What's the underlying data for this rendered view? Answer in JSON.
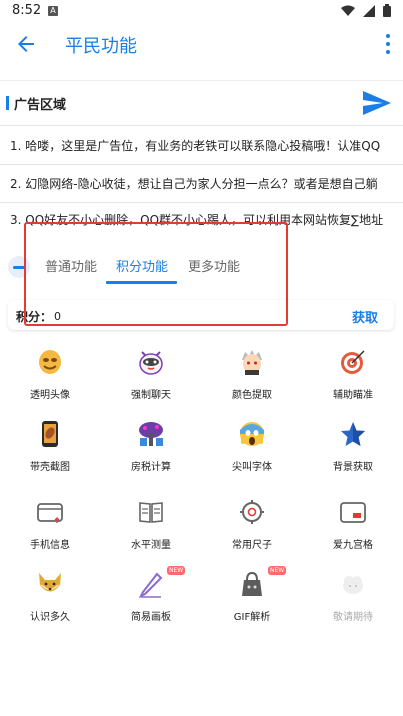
{
  "status": {
    "time": "8:52",
    "badge": "A"
  },
  "appbar": {
    "title": "平民功能"
  },
  "ad": {
    "title": "广告区域",
    "lines": [
      "1.  哈喽，这里是广告位，有业务的老铁可以联系隐心投稿哦！认准QQ",
      "2.  幻隐网络-隐心收徒，想让自己为家人分担一点么？或者是想自己躺",
      "3.  QQ好友不小心删除，QQ群不小心踢人，可以利用本网站恢复∑地址"
    ]
  },
  "tabs": {
    "items": [
      "普通功能",
      "积分功能",
      "更多功能"
    ]
  },
  "points": {
    "label": "积分：",
    "value": "0",
    "action": "获取"
  },
  "grid": {
    "items": [
      {
        "label": "透明头像",
        "icon": "mask-icon"
      },
      {
        "label": "强制聊天",
        "icon": "robot-icon"
      },
      {
        "label": "颜色提取",
        "icon": "avatar-icon"
      },
      {
        "label": "辅助瞄准",
        "icon": "target-icon"
      },
      {
        "label": "带壳截图",
        "icon": "phone-icon"
      },
      {
        "label": "房税计算",
        "icon": "house-tree-icon"
      },
      {
        "label": "尖叫字体",
        "icon": "scream-icon"
      },
      {
        "label": "背景获取",
        "icon": "star-icon"
      },
      {
        "label": "手机信息",
        "icon": "card-icon"
      },
      {
        "label": "水平测量",
        "icon": "book-icon"
      },
      {
        "label": "常用尺子",
        "icon": "gear-icon"
      },
      {
        "label": "爱九宫格",
        "icon": "window-icon"
      },
      {
        "label": "认识多久",
        "icon": "fox-icon"
      },
      {
        "label": "简易画板",
        "icon": "pen-icon",
        "badge": "NEW"
      },
      {
        "label": "GIF解析",
        "icon": "bag-icon",
        "badge": "NEW"
      },
      {
        "label": "敬请期待",
        "icon": "cloud-icon"
      }
    ]
  }
}
